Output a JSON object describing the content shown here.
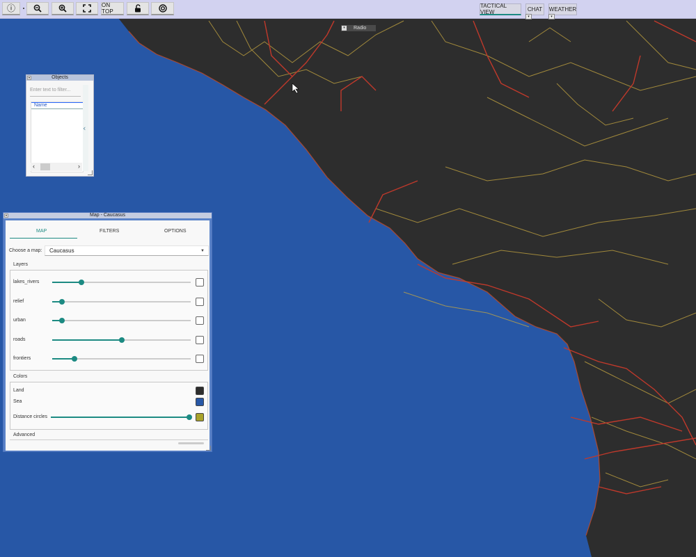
{
  "toolbar": {
    "info_icon": "info-icon",
    "zoom_out_icon": "zoom-out-icon",
    "zoom_in_icon": "zoom-in-icon",
    "fullscreen_icon": "fullscreen-icon",
    "on_top_label": "ON TOP",
    "lock_icon": "unlock-icon",
    "target_icon": "target-icon",
    "tabs": [
      {
        "label": "TACTICAL VIEW",
        "active": true
      },
      {
        "label": "CHAT",
        "active": false
      },
      {
        "label": "WEATHER",
        "active": false
      }
    ]
  },
  "radio": {
    "label": "Radio"
  },
  "objects_panel": {
    "title": "Objects",
    "filter_placeholder": "Enter text to filter...",
    "column_name": "Name"
  },
  "map_panel": {
    "title": "Map - Caucasus",
    "tabs": [
      {
        "label": "MAP",
        "active": true
      },
      {
        "label": "FILTERS",
        "active": false
      },
      {
        "label": "OPTIONS",
        "active": false
      }
    ],
    "choose_map_label": "Choose a map:",
    "choose_map_value": "Caucasus",
    "layers_title": "Layers",
    "layers": [
      {
        "name": "lakes_rivers",
        "value": 0.21,
        "checked": false
      },
      {
        "name": "relief",
        "value": 0.07,
        "checked": false
      },
      {
        "name": "urban",
        "value": 0.07,
        "checked": false
      },
      {
        "name": "roads",
        "value": 0.5,
        "checked": false
      },
      {
        "name": "frontiers",
        "value": 0.16,
        "checked": false
      }
    ],
    "colors_title": "Colors",
    "colors": [
      {
        "name": "Land",
        "color": "#2d2d2d"
      },
      {
        "name": "Sea",
        "color": "#2757a6"
      }
    ],
    "distance_circles": {
      "label": "Distance circles",
      "value": 1.0,
      "color": "#a8a22a"
    },
    "advanced_title": "Advanced"
  },
  "map_colors": {
    "sea": "#2757a6",
    "land": "#2d2d2d",
    "major_roads": "#c0392b",
    "minor_roads": "#c8a840"
  }
}
